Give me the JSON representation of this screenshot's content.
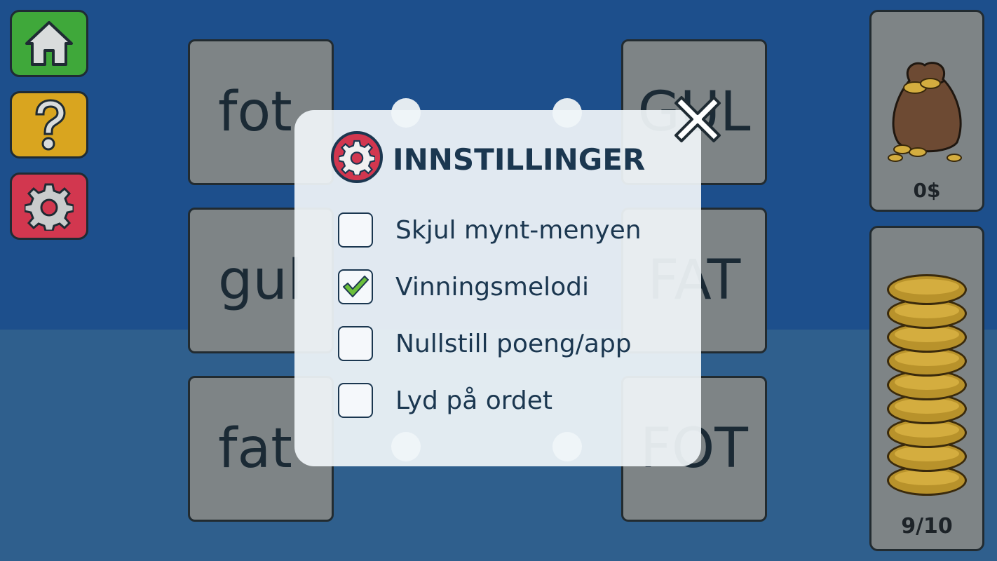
{
  "sidebar": {
    "home_icon": "home-icon",
    "help_icon": "question-icon",
    "settings_icon": "gear-icon"
  },
  "cards": {
    "left": [
      "fot",
      "gul",
      "fat"
    ],
    "right": [
      "GUL",
      "FAT",
      "FOT"
    ]
  },
  "coins": {
    "money_label": "0$",
    "progress_label": "9/10"
  },
  "settings_modal": {
    "title": "INNSTILLINGER",
    "options": [
      {
        "label": "Skjul mynt-menyen",
        "checked": false
      },
      {
        "label": "Vinningsmelodi",
        "checked": true
      },
      {
        "label": "Nullstill poeng/app",
        "checked": false
      },
      {
        "label": "Lyd på ordet",
        "checked": false
      }
    ]
  },
  "colors": {
    "background": "#1d4f8c",
    "home_button": "#3fa83a",
    "help_button": "#d9a51f",
    "settings_button": "#d2374f",
    "card": "#7e8486",
    "check_mark": "#6bbf3a"
  }
}
